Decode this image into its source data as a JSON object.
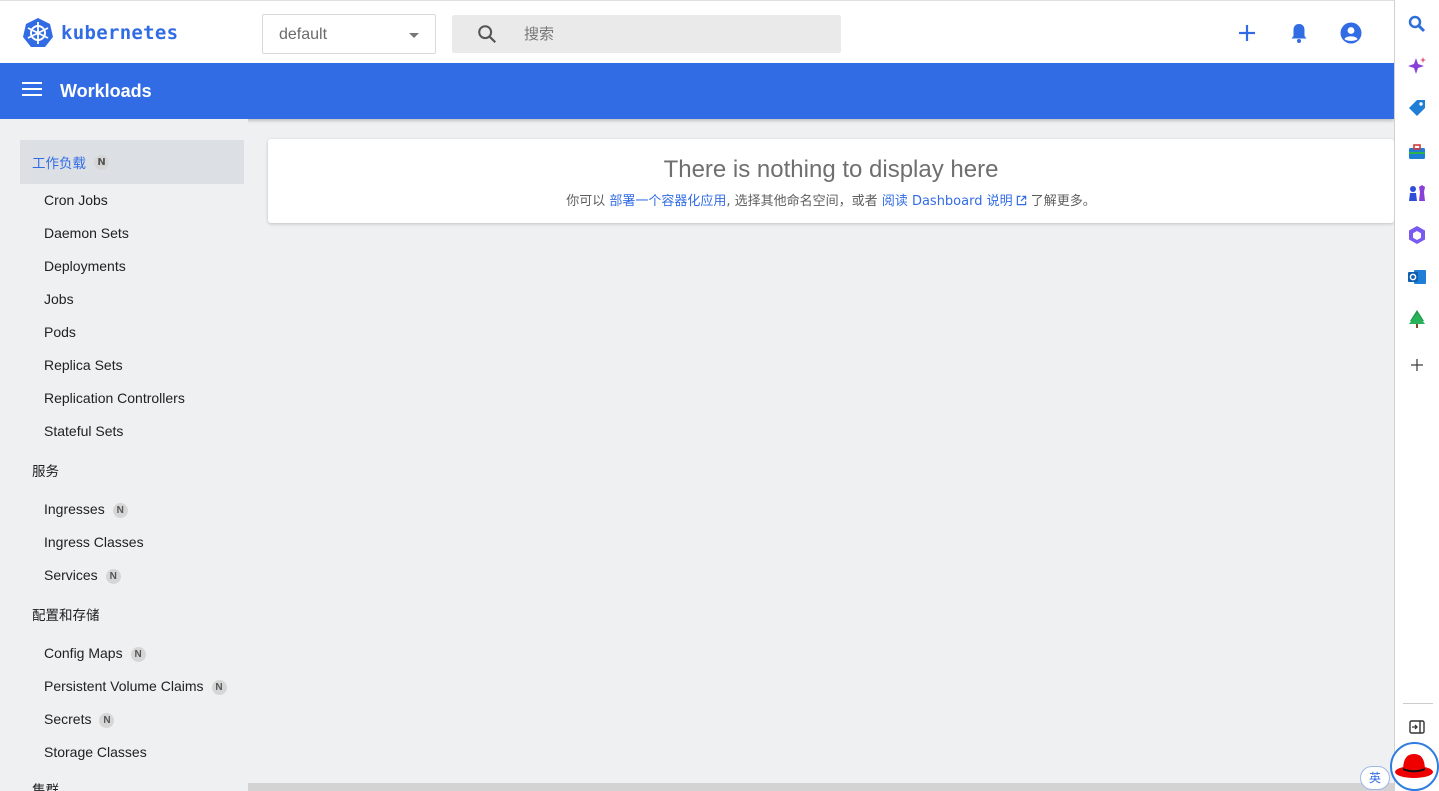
{
  "header": {
    "brand": "kubernetes",
    "namespace": "default",
    "search_placeholder": "搜索"
  },
  "titlebar": {
    "title": "Workloads"
  },
  "sidebar": {
    "workloads_group": {
      "label": "工作负载",
      "badge": "N"
    },
    "workloads": [
      "Cron Jobs",
      "Daemon Sets",
      "Deployments",
      "Jobs",
      "Pods",
      "Replica Sets",
      "Replication Controllers",
      "Stateful Sets"
    ],
    "services_group": {
      "label": "服务"
    },
    "services": [
      {
        "label": "Ingresses",
        "badge": "N"
      },
      {
        "label": "Ingress Classes",
        "badge": ""
      },
      {
        "label": "Services",
        "badge": "N"
      }
    ],
    "config_group": {
      "label": "配置和存储"
    },
    "config": [
      {
        "label": "Config Maps",
        "badge": "N"
      },
      {
        "label": "Persistent Volume Claims",
        "badge": "N"
      },
      {
        "label": "Secrets",
        "badge": "N"
      },
      {
        "label": "Storage Classes",
        "badge": ""
      }
    ],
    "cluster_group": {
      "label": "集群"
    }
  },
  "empty_state": {
    "title": "There is nothing to display here",
    "text_1": "你可以 ",
    "link_deploy": "部署一个容器化应用",
    "text_2": ", 选择其他命名空间，或者 ",
    "link_docs": "阅读 Dashboard 说明",
    "text_3": " 了解更多。"
  },
  "ime": {
    "label": "英"
  },
  "colors": {
    "brand": "#326ce5",
    "background": "#eef0f2"
  },
  "side_panel_icons": [
    "search-icon",
    "copilot-icon",
    "tag-icon",
    "toolbox-icon",
    "chess-icon",
    "office-icon",
    "outlook-icon",
    "tree-icon",
    "add-icon",
    "sidebar-toggle-icon"
  ]
}
